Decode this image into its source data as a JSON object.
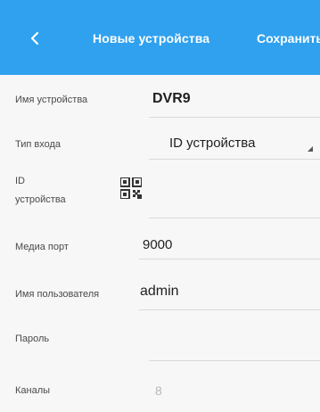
{
  "header": {
    "title": "Новые устройства",
    "save_label": "Сохранить"
  },
  "form": {
    "device_name_label": "Имя устройства",
    "device_name_value": "DVR9",
    "input_type_label": "Тип входа",
    "input_type_value": "ID устройства",
    "device_id_label_line1": "ID",
    "device_id_label_line2": "устройства",
    "device_id_value": "",
    "media_port_label": "Медиа порт",
    "media_port_value": "9000",
    "username_label": "Имя пользователя",
    "username_value": "admin",
    "password_label": "Пароль",
    "password_value": "",
    "channels_label": "Каналы",
    "channels_value": "8"
  },
  "colors": {
    "header_bg": "#30a1ee",
    "page_bg": "#f7f7f7"
  },
  "icons": {
    "back": "chevron-left-icon",
    "qr": "qr-code-icon",
    "dropdown": "dropdown-caret-icon"
  }
}
